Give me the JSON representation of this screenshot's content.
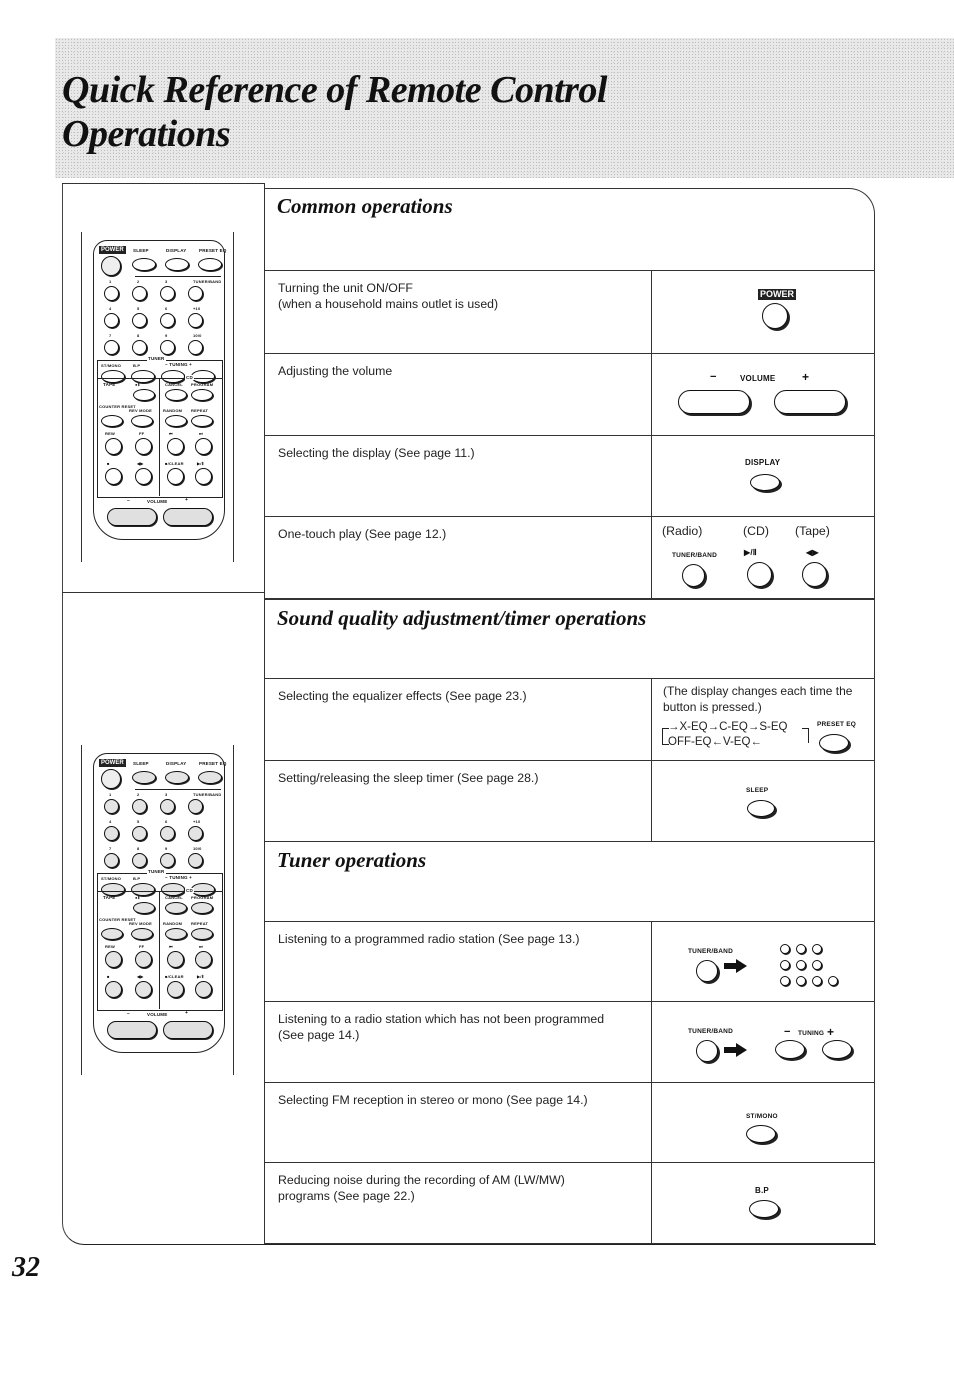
{
  "page": {
    "title_line1": "Quick Reference of Remote Control",
    "title_line2": "Operations",
    "page_number": "32"
  },
  "remote": {
    "power": "POWER",
    "top_row": [
      "SLEEP",
      "DISPLAY",
      "PRESET EQ"
    ],
    "numpad_labels": [
      "1",
      "2",
      "3",
      "TUNER/BAND",
      "4",
      "5",
      "6",
      "+10",
      "7",
      "8",
      "9",
      "10/0"
    ],
    "tuner_group": "TUNER",
    "tuner_row": [
      "ST/MONO",
      "B.P",
      "−  TUNING  +"
    ],
    "cd_group": "CD",
    "tape_label": "TAPE",
    "tape_rows": [
      "●Ⅱ",
      "COUNTER RESET",
      "REV MODE",
      "REW",
      "FF",
      "■",
      "◀▶"
    ],
    "cd_rows": [
      "CANCEL",
      "PROGRAM",
      "RANDOM",
      "REPEAT",
      "⏮",
      "⏭",
      "■/CLEAR",
      "▶/Ⅱ"
    ],
    "volume": "VOLUME",
    "vol_minus": "−",
    "vol_plus": "+"
  },
  "sections": [
    {
      "heading": "Common operations",
      "rows": [
        {
          "desc": "Turning the unit ON/OFF\n(when a household mains outlet is used)",
          "buttons": [
            "POWER"
          ]
        },
        {
          "desc": "Adjusting the volume",
          "buttons": [
            "−",
            "VOLUME",
            "+"
          ]
        },
        {
          "desc": "Selecting the display (See page 11.)",
          "buttons": [
            "DISPLAY"
          ]
        },
        {
          "desc": "One-touch play (See page 12.)",
          "modes": [
            "(Radio)",
            "(CD)",
            "(Tape)"
          ],
          "buttons": [
            "TUNER/BAND",
            "▶/Ⅱ",
            "◀▶"
          ]
        }
      ]
    },
    {
      "heading": "Sound quality adjustment/timer operations",
      "rows": [
        {
          "desc": "Selecting the equalizer effects (See page 23.)",
          "note": "(The display changes each time the button is pressed.)",
          "cycle_top": "→X-EQ→C-EQ→S-EQ",
          "cycle_bottom": "OFF-EQ←V-EQ←",
          "buttons": [
            "PRESET EQ"
          ]
        },
        {
          "desc": "Setting/releasing the sleep timer (See page 28.)",
          "buttons": [
            "SLEEP"
          ]
        }
      ]
    },
    {
      "heading": "Tuner operations",
      "rows": [
        {
          "desc": "Listening to a programmed radio station (See page 13.)",
          "buttons": [
            "TUNER/BAND",
            "numeric keys"
          ]
        },
        {
          "desc": "Listening to a radio station which has not been programmed\n(See page 14.)",
          "buttons": [
            "TUNER/BAND",
            "−",
            "TUNING",
            "+"
          ]
        },
        {
          "desc": "Selecting FM reception in stereo or mono (See page 14.)",
          "buttons": [
            "ST/MONO"
          ]
        },
        {
          "desc": "Reducing noise during the recording of AM (LW/MW)\nprograms (See page 22.)",
          "buttons": [
            "B.P"
          ]
        }
      ]
    }
  ]
}
